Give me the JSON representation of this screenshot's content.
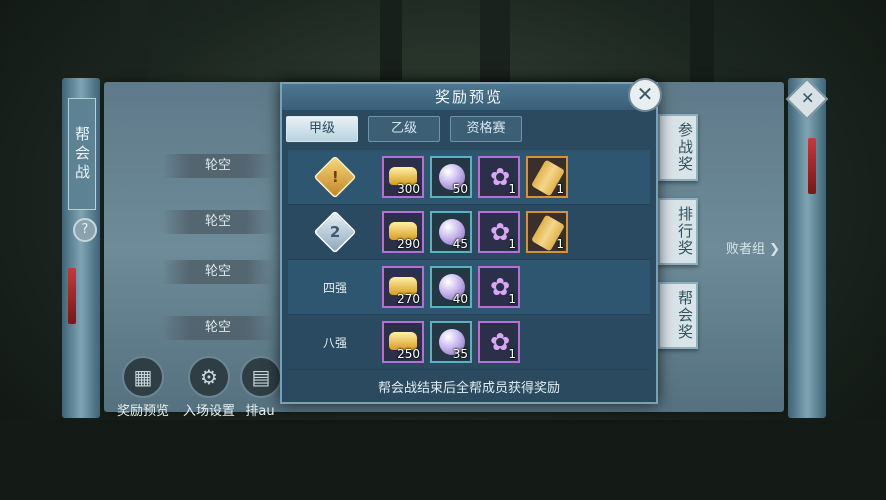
{
  "background_panel": {
    "vertical_title": "帮会战",
    "help_label": "?",
    "bye_labels": [
      "轮空",
      "轮空",
      "轮空",
      "轮空"
    ],
    "bottom_buttons": [
      "奖励预览",
      "入场设置",
      "排au"
    ],
    "loser_group": "败者组",
    "side_tags": [
      "参战奖",
      "排行奖",
      "帮会奖"
    ]
  },
  "modal": {
    "title": "奖励预览",
    "close_icon": "close-icon",
    "tabs": [
      "甲级",
      "乙级",
      "资格赛"
    ],
    "active_tab": "甲级",
    "rows": [
      {
        "rank_label": "",
        "rank_badge": "!",
        "rewards": [
          {
            "icon": "gold-ingot-icon",
            "qty": "300"
          },
          {
            "icon": "pearl-icon",
            "qty": "50"
          },
          {
            "icon": "flower-icon",
            "qty": "1"
          },
          {
            "icon": "scroll-icon",
            "qty": "1"
          }
        ]
      },
      {
        "rank_label": "",
        "rank_badge": "2",
        "rewards": [
          {
            "icon": "gold-ingot-icon",
            "qty": "290"
          },
          {
            "icon": "pearl-icon",
            "qty": "45"
          },
          {
            "icon": "flower-icon",
            "qty": "1"
          },
          {
            "icon": "scroll-icon",
            "qty": "1"
          }
        ]
      },
      {
        "rank_label": "四强",
        "rank_badge": "",
        "rewards": [
          {
            "icon": "gold-ingot-icon",
            "qty": "270"
          },
          {
            "icon": "pearl-icon",
            "qty": "40"
          },
          {
            "icon": "flower-icon",
            "qty": "1"
          }
        ]
      },
      {
        "rank_label": "八强",
        "rank_badge": "",
        "rewards": [
          {
            "icon": "gold-ingot-icon",
            "qty": "250"
          },
          {
            "icon": "pearl-icon",
            "qty": "35"
          },
          {
            "icon": "flower-icon",
            "qty": "1"
          }
        ]
      }
    ],
    "footer": "帮会战结束后全帮成员获得奖励"
  }
}
